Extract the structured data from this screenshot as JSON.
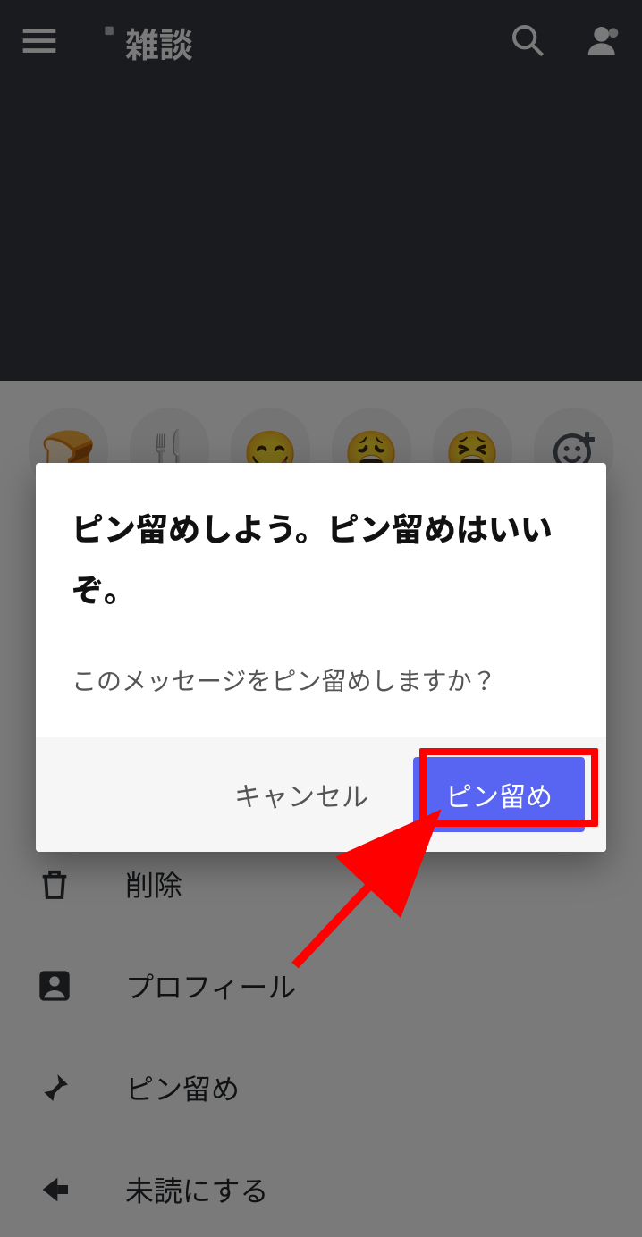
{
  "header": {
    "channel_name": "雑談"
  },
  "sheet": {
    "emojis": [
      "🍞",
      "🍴",
      "😋",
      "😩",
      "😫"
    ],
    "menu": {
      "delete": "削除",
      "profile": "プロフィール",
      "pin": "ピン留め",
      "unread": "未読にする"
    }
  },
  "dialog": {
    "title": "ピン留めしよう。ピン留めはいいぞ。",
    "message": "このメッセージをピン留めしますか？",
    "cancel": "キャンセル",
    "confirm": "ピン留め"
  }
}
